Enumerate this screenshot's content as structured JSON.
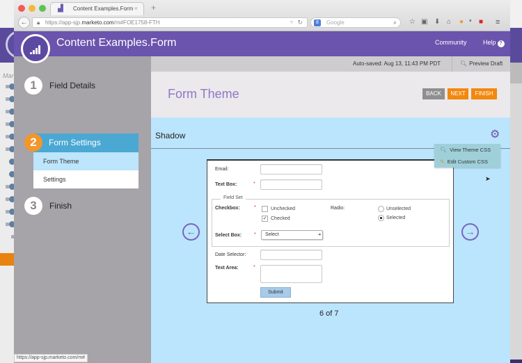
{
  "browser": {
    "tab_title": "Content Examples.Form",
    "tab_close": "×",
    "new_tab": "+",
    "url_prefix": "https://app-sjp.",
    "url_domain": "marketo.com",
    "url_suffix": "/m#FOE1758-FTH",
    "search_placeholder": "Google",
    "search_engine_glyph": "8",
    "status_url": "https://app-sjp.marketo.com/m#",
    "icons": [
      "back-icon",
      "lock-icon",
      "reload-icon",
      "search-icon",
      "bookmark-star-icon",
      "clipboard-icon",
      "download-icon",
      "home-icon",
      "extension-icon",
      "addon-icon",
      "menu-icon"
    ]
  },
  "header": {
    "app_title": "Content Examples.Form",
    "community": "Community",
    "help": "Help",
    "help_icon": "?"
  },
  "sidebar": {
    "steps": [
      {
        "number": "1",
        "label": "Field Details"
      },
      {
        "number": "2",
        "label": "Form Settings",
        "active": true
      },
      {
        "number": "3",
        "label": "Finish"
      }
    ],
    "substeps": [
      {
        "label": "Form Theme",
        "active": true
      },
      {
        "label": "Settings",
        "active": false
      }
    ]
  },
  "topbar": {
    "autosaved": "Auto-saved: Aug 13, 11:43 PM PDT",
    "preview_draft": "Preview Draft"
  },
  "title_area": {
    "title": "Form Theme",
    "back": "BACK",
    "next": "NEXT",
    "finish": "FINISH"
  },
  "theme": {
    "name": "Shadow",
    "menu": [
      {
        "icon": "magnifier-icon",
        "label": "View Theme CSS"
      },
      {
        "icon": "pencil-icon",
        "label": "Edit Custom CSS"
      }
    ],
    "pager": "6 of 7",
    "colors": {
      "accent": "#6a54ad",
      "orange": "#f2880d",
      "light_blue": "#bbe5fc",
      "step_blue": "#4aa8d3"
    }
  },
  "form": {
    "email_label": "Email:",
    "textbox_label": "Text Box:",
    "required_mark": "*",
    "fieldset_legend": "Field Set",
    "checkbox_label": "Checkbox:",
    "checkbox_options": [
      {
        "label": "Unchecked",
        "checked": false
      },
      {
        "label": "Checked",
        "checked": true
      }
    ],
    "radio_label": "Radio:",
    "radio_options": [
      {
        "label": "Unselected",
        "selected": false
      },
      {
        "label": "Selected",
        "selected": true
      }
    ],
    "select_label": "Select Box:",
    "select_value": "Select",
    "date_label": "Date Selector:",
    "textarea_label": "Text Area:",
    "submit": "Submit"
  },
  "background_app": {
    "partial_label": "Mar"
  }
}
